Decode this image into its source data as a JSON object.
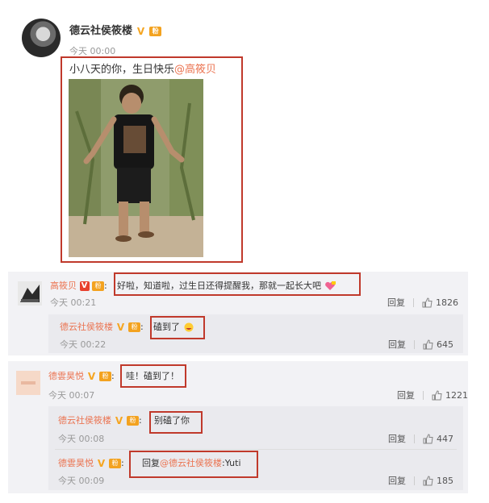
{
  "post": {
    "author": "德云社侯筱楼",
    "time": "今天 00:00",
    "text_main": "小八天的你，生日快乐",
    "text_mention": "@高筱贝"
  },
  "comments": [
    {
      "author": "高筱贝",
      "separator": ":",
      "text": "好啦，知道啦，过生日还得提醒我，那就一起长大吧",
      "time": "今天 00:21",
      "reply_label": "回复",
      "likes": "1826",
      "replies": [
        {
          "author": "德云社侯筱楼",
          "separator": ":",
          "text": "磕到了",
          "time": "今天 00:22",
          "reply_label": "回复",
          "likes": "645"
        }
      ]
    },
    {
      "author": "德雲昊悦",
      "separator": ":",
      "text": "哇！磕到了！",
      "time": "今天 00:07",
      "reply_label": "回复",
      "likes": "1221",
      "replies": [
        {
          "author": "德云社侯筱楼",
          "separator": ":",
          "text": "别磕了你",
          "time": "今天 00:08",
          "reply_label": "回复",
          "likes": "447"
        },
        {
          "author": "德雲昊悦",
          "separator": ":",
          "text_prefix": "回复",
          "text_mention": "@德云社侯筱楼",
          "text_suffix": ":Yuti",
          "time": "今天 00:09",
          "reply_label": "回复",
          "likes": "185"
        }
      ]
    }
  ],
  "icons": {
    "verified": "V",
    "verified_red": "V",
    "fan_badge": "粉"
  },
  "colors": {
    "mention": "#eb7350",
    "highlight_box": "#c0392b",
    "verified": "#f5a623",
    "comment_bg": "#f2f2f5"
  }
}
